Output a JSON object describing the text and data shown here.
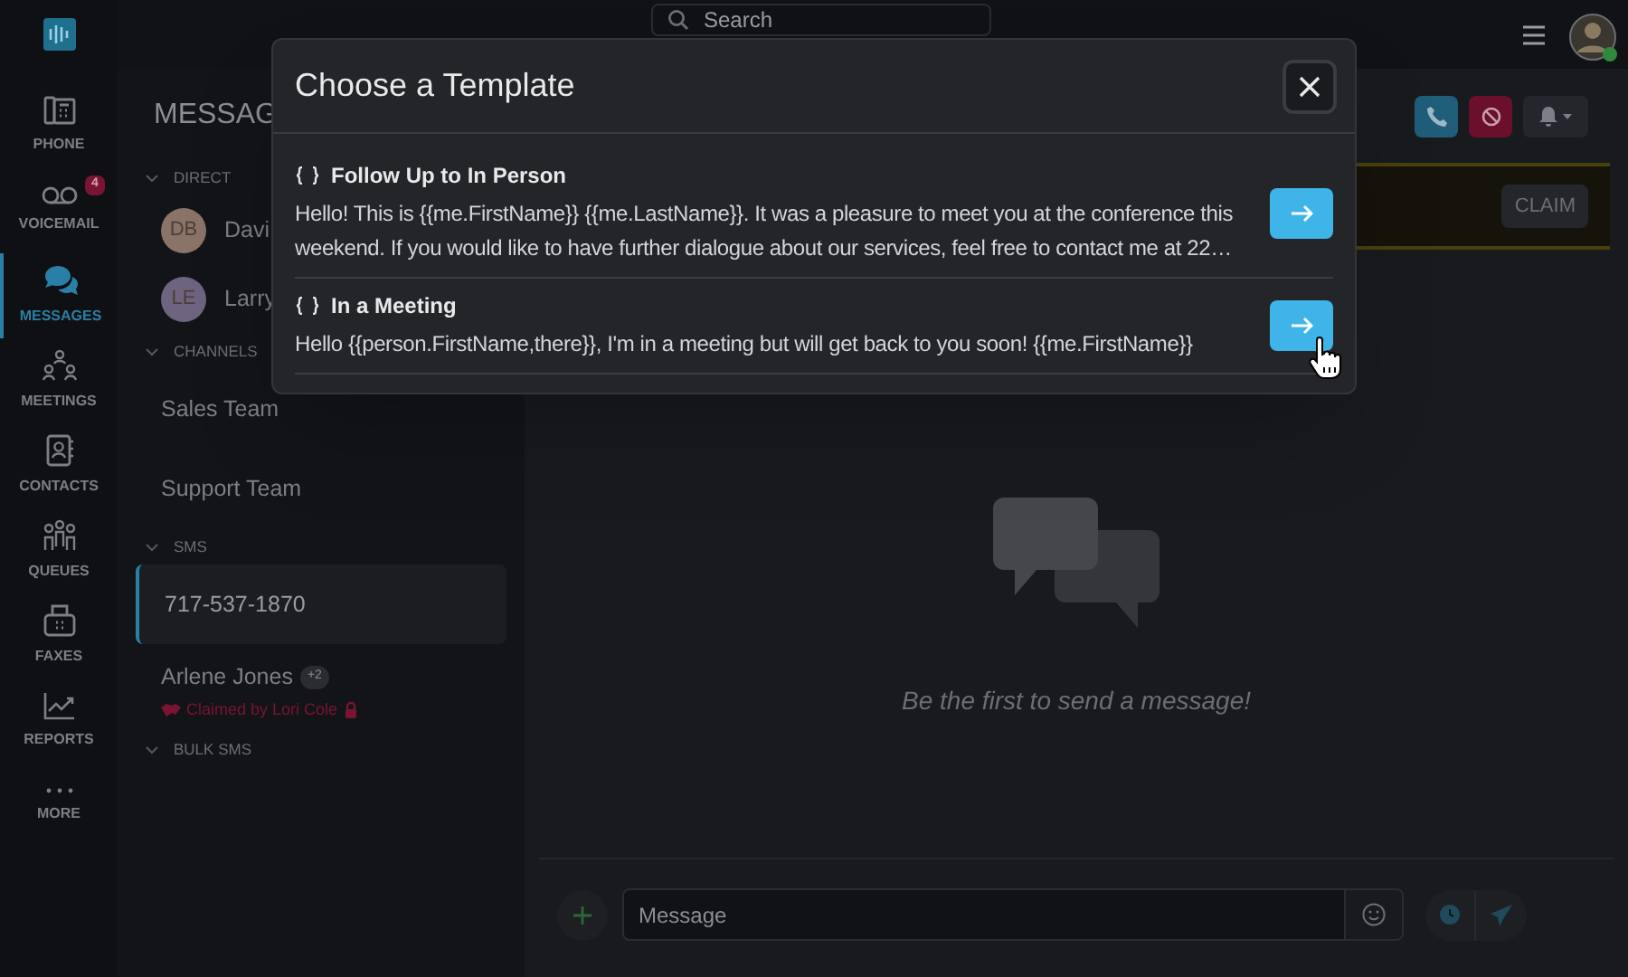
{
  "nav": {
    "items": [
      {
        "label": "PHONE",
        "selected": false
      },
      {
        "label": "VOICEMAIL",
        "selected": false,
        "badge": "4"
      },
      {
        "label": "MESSAGES",
        "selected": true
      },
      {
        "label": "MEETINGS",
        "selected": false
      },
      {
        "label": "CONTACTS",
        "selected": false
      },
      {
        "label": "QUEUES",
        "selected": false
      },
      {
        "label": "FAXES",
        "selected": false
      },
      {
        "label": "REPORTS",
        "selected": false
      },
      {
        "label": "MORE",
        "selected": false
      }
    ]
  },
  "top_bar": {
    "search": {
      "placeholder": "Search"
    }
  },
  "conversations": {
    "title": "MESSAG",
    "sections": [
      {
        "label": "DIRECT",
        "items": [
          {
            "kind": "contact",
            "initials": "DB",
            "name": "Davi",
            "color": "#8a7468",
            "selected": false
          },
          {
            "kind": "contact",
            "initials": "LE",
            "name": "Larry",
            "color": "#6f6480",
            "selected": false
          }
        ]
      },
      {
        "label": "CHANNELS",
        "items": [
          {
            "kind": "channel",
            "name": "Sales Team",
            "selected": false
          },
          {
            "kind": "channel",
            "name": "Support Team",
            "selected": false
          }
        ]
      },
      {
        "label": "SMS",
        "items": [
          {
            "kind": "channel",
            "name": "717-537-1870",
            "selected": true
          },
          {
            "kind": "claimed",
            "name": "Arlene Jones",
            "badge": "+2",
            "claim": "Claimed by Lori Cole",
            "selected": false
          }
        ]
      },
      {
        "label": "BULK SMS"
      }
    ]
  },
  "conversation": {
    "banner": {
      "button": "CLAIM"
    },
    "empty_state": "Be the first to send a message!",
    "composer": {
      "placeholder": "Message"
    }
  },
  "modal": {
    "title": "Choose a Template",
    "templates": [
      {
        "name": "Follow Up to In Person",
        "body": "Hello! This is {{me.FirstName}} {{me.LastName}}. It was a pleasure to meet you at the conference this weekend. If you would like to have further dialogue about our services, feel free to contact me at 22…"
      },
      {
        "name": "In a Meeting",
        "body": "Hello {{person.FirstName,there}}, I'm in a meeting but will get back to you soon! {{me.FirstName}}"
      }
    ]
  }
}
